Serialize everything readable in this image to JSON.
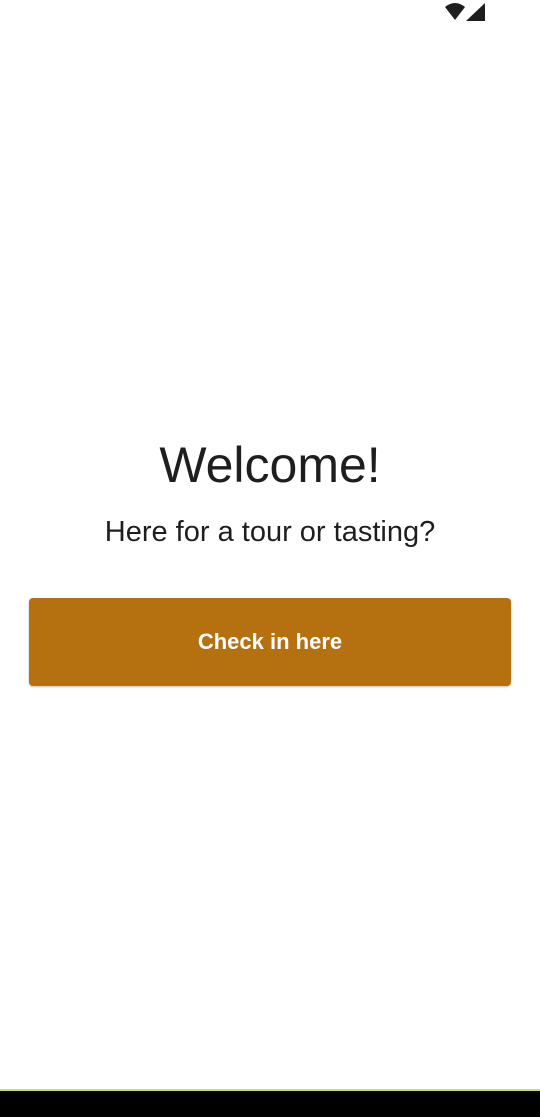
{
  "status_bar": {
    "icons": [
      "wifi-icon",
      "cellular-signal-icon"
    ]
  },
  "main": {
    "title": "Welcome!",
    "subtitle": "Here for a tour or tasting?",
    "checkin_button_label": "Check in here"
  },
  "colors": {
    "accent": "#b57110",
    "text": "#1e1e1e",
    "background": "#ffffff",
    "nav_bar": "#000000",
    "bottom_accent": "#c6e06a",
    "status_icons": "#1e1e1e"
  }
}
